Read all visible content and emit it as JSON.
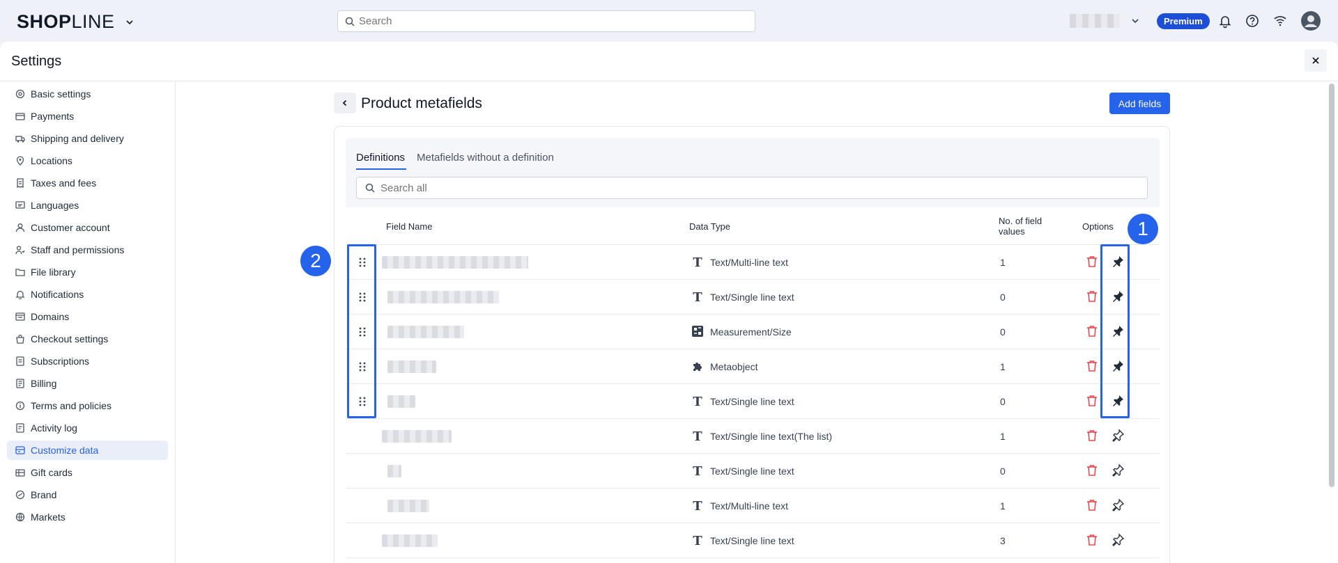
{
  "app": {
    "logo_bold": "SHOP",
    "logo_light": "LINE",
    "search_placeholder": "Search",
    "plan_badge": "Premium"
  },
  "panel": {
    "title": "Settings"
  },
  "sidebar": {
    "items": [
      {
        "label": "Basic settings",
        "icon": "settings-gear-icon"
      },
      {
        "label": "Payments",
        "icon": "payments-icon"
      },
      {
        "label": "Shipping and delivery",
        "icon": "truck-icon"
      },
      {
        "label": "Locations",
        "icon": "location-pin-icon"
      },
      {
        "label": "Taxes and fees",
        "icon": "receipt-icon"
      },
      {
        "label": "Languages",
        "icon": "language-icon"
      },
      {
        "label": "Customer account",
        "icon": "user-icon"
      },
      {
        "label": "Staff and permissions",
        "icon": "staff-icon"
      },
      {
        "label": "File library",
        "icon": "folder-icon"
      },
      {
        "label": "Notifications",
        "icon": "bell-icon"
      },
      {
        "label": "Domains",
        "icon": "domain-icon"
      },
      {
        "label": "Checkout settings",
        "icon": "bag-icon"
      },
      {
        "label": "Subscriptions",
        "icon": "subscription-icon"
      },
      {
        "label": "Billing",
        "icon": "billing-icon"
      },
      {
        "label": "Terms and policies",
        "icon": "info-icon"
      },
      {
        "label": "Activity log",
        "icon": "log-icon"
      },
      {
        "label": "Customize data",
        "icon": "database-icon",
        "active": true
      },
      {
        "label": "Gift cards",
        "icon": "gift-card-icon"
      },
      {
        "label": "Brand",
        "icon": "brand-icon"
      },
      {
        "label": "Markets",
        "icon": "globe-icon"
      }
    ]
  },
  "main": {
    "title": "Product metafields",
    "add_button": "Add fields",
    "tabs": [
      {
        "label": "Definitions",
        "active": true
      },
      {
        "label": "Metafields without a definition",
        "active": false
      }
    ],
    "search_placeholder": "Search all",
    "columns": {
      "field_name": "Field Name",
      "data_type": "Data Type",
      "count": "No. of field values",
      "options": "Options"
    },
    "rows": [
      {
        "data_type": "Text/Multi-line text",
        "type_icon": "text-icon",
        "count": "1",
        "pinned": true
      },
      {
        "data_type": "Text/Single line text",
        "type_icon": "text-icon",
        "count": "0",
        "pinned": true
      },
      {
        "data_type": "Measurement/Size",
        "type_icon": "measurement-icon",
        "count": "0",
        "pinned": true
      },
      {
        "data_type": "Metaobject",
        "type_icon": "puzzle-icon",
        "count": "1",
        "pinned": true
      },
      {
        "data_type": "Text/Single line text",
        "type_icon": "text-icon",
        "count": "0",
        "pinned": true
      },
      {
        "data_type": "Text/Single line text(The list)",
        "type_icon": "text-icon",
        "count": "1",
        "pinned": false
      },
      {
        "data_type": "Text/Single line text",
        "type_icon": "text-icon",
        "count": "0",
        "pinned": false
      },
      {
        "data_type": "Text/Multi-line text",
        "type_icon": "text-icon",
        "count": "1",
        "pinned": false
      },
      {
        "data_type": "Text/Single line text",
        "type_icon": "text-icon",
        "count": "3",
        "pinned": false
      }
    ]
  },
  "annotations": {
    "badge_1": "1",
    "badge_2": "2"
  },
  "colors": {
    "accent": "#2563eb",
    "danger": "#e5484d"
  }
}
